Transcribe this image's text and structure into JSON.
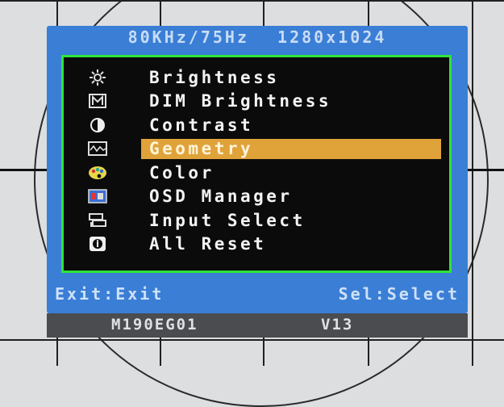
{
  "header": {
    "frequency": "80KHz/75Hz",
    "resolution": "1280x1024"
  },
  "menu": {
    "items": [
      {
        "label": "Brightness",
        "icon": "sun-icon"
      },
      {
        "label": "DIM Brightness",
        "icon": "dim-m-icon"
      },
      {
        "label": "Contrast",
        "icon": "contrast-icon"
      },
      {
        "label": "Geometry",
        "icon": "geometry-wave-icon",
        "selected": true
      },
      {
        "label": "Color",
        "icon": "palette-icon"
      },
      {
        "label": "OSD Manager",
        "icon": "osd-icon"
      },
      {
        "label": "Input Select",
        "icon": "input-icon"
      },
      {
        "label": "All Reset",
        "icon": "reset-icon"
      }
    ]
  },
  "footer": {
    "exit": "Exit:Exit",
    "select": "Sel:Select"
  },
  "model_bar": {
    "model": "M190EG01",
    "version": "V13"
  },
  "colors": {
    "osd_blue": "#3a7ed6",
    "border_green": "#2fe33a",
    "highlight": "#e0a33a"
  }
}
